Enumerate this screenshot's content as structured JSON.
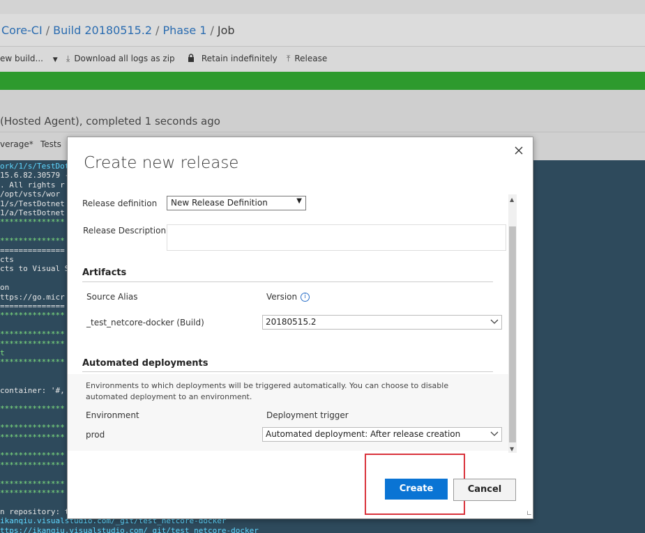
{
  "breadcrumb": [
    "Core-CI",
    "Build 20180515.2",
    "Phase 1",
    "Job"
  ],
  "toolbar": {
    "queue_new_build": "ew build...",
    "download_logs": "Download all logs as zip",
    "retain": "Retain indefinitely",
    "release": "Release"
  },
  "status": "(Hosted Agent), completed 1 seconds ago",
  "tabs": [
    "verage*",
    "Tests"
  ],
  "console_lines": [
    {
      "text": "ork/1/s/TestDot",
      "color": "cyan"
    },
    {
      "text": "15.6.82.30579 -",
      "color": "white"
    },
    {
      "text": ". All rights r",
      "color": "white"
    },
    {
      "text": "/opt/vsts/wor",
      "color": "white"
    },
    {
      "text": "1/s/TestDotnet",
      "color": "white"
    },
    {
      "text": "1/a/TestDotnet",
      "color": "white"
    },
    {
      "text": "**************",
      "color": "green"
    },
    {
      "text": "",
      "color": "white"
    },
    {
      "text": "**************",
      "color": "green"
    },
    {
      "text": "==============",
      "color": "white"
    },
    {
      "text": "cts",
      "color": "white"
    },
    {
      "text": "cts to Visual S",
      "color": "white"
    },
    {
      "text": "",
      "color": "white"
    },
    {
      "text": "on",
      "color": "white"
    },
    {
      "text": "ttps://go.micr",
      "color": "white"
    },
    {
      "text": "==============",
      "color": "white"
    },
    {
      "text": "**************",
      "color": "green"
    },
    {
      "text": "",
      "color": "white"
    },
    {
      "text": "**************",
      "color": "green"
    },
    {
      "text": "**************",
      "color": "green"
    },
    {
      "text": "t",
      "color": "green"
    },
    {
      "text": "**************",
      "color": "green"
    },
    {
      "text": "",
      "color": "white"
    },
    {
      "text": "",
      "color": "white"
    },
    {
      "text": " container: '#,",
      "color": "white"
    },
    {
      "text": "",
      "color": "white"
    },
    {
      "text": "**************",
      "color": "green"
    },
    {
      "text": "",
      "color": "white"
    },
    {
      "text": "**************",
      "color": "green"
    },
    {
      "text": "**************",
      "color": "green"
    },
    {
      "text": "",
      "color": "white"
    },
    {
      "text": "**************",
      "color": "green"
    },
    {
      "text": "**************",
      "color": "green"
    },
    {
      "text": "",
      "color": "white"
    },
    {
      "text": "**************",
      "color": "green"
    },
    {
      "text": "**************",
      "color": "green"
    },
    {
      "text": "",
      "color": "white"
    },
    {
      "text": "n repository: te",
      "color": "white"
    },
    {
      "text": "ikanqiu.visualstudio.com/_git/test_netcore-docker",
      "color": "cyan"
    },
    {
      "text": "ttps://ikanqiu.visualstudio.com/_git/test_netcore-docker",
      "color": "cyan"
    }
  ],
  "dialog": {
    "title": "Create new release",
    "release_definition_label": "Release definition",
    "release_definition_value": "New Release Definition",
    "release_description_label": "Release Description",
    "release_description_value": "",
    "artifacts_heading": "Artifacts",
    "source_alias_header": "Source Alias",
    "version_header": "Version",
    "artifact_alias": "_test_netcore-docker (Build)",
    "artifact_version": "20180515.2",
    "automated_heading": "Automated deployments",
    "automated_desc": "Environments to which deployments will be triggered automatically. You can choose to disable automated deployment to an environment.",
    "environment_header": "Environment",
    "trigger_header": "Deployment trigger",
    "environment_name": "prod",
    "trigger_value": "Automated deployment: After release creation",
    "create_label": "Create",
    "cancel_label": "Cancel"
  },
  "colors": {
    "primary_button": "#0a74d4",
    "success_bar": "#2d9a2d",
    "highlight_box": "#d9313a",
    "console_bg": "#2e4a5c"
  },
  "icons": [
    "download-icon",
    "lock-icon",
    "release-icon",
    "close-icon",
    "info-icon",
    "chevron-down-icon",
    "resize-grip-icon"
  ]
}
